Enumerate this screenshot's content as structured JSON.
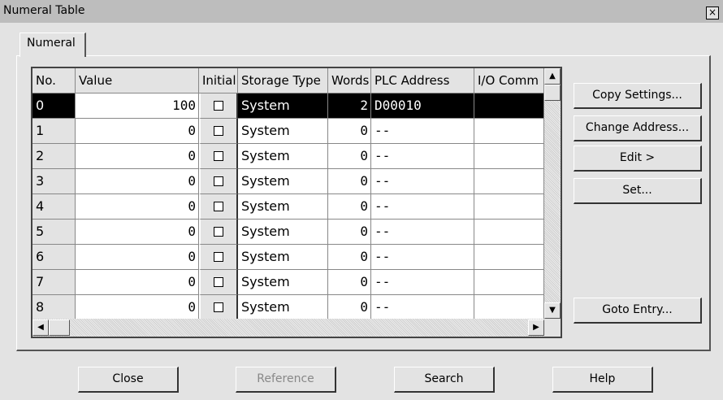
{
  "window": {
    "title": "Numeral Table",
    "close_label": "×"
  },
  "tabs": [
    {
      "label": "Numeral"
    }
  ],
  "table": {
    "columns": [
      "No.",
      "Value",
      "Initial",
      "Storage Type",
      "Words",
      "PLC Address",
      "I/O Comm"
    ],
    "rows": [
      {
        "no": "0",
        "value": "100",
        "initial": false,
        "storage": "System",
        "words": "2",
        "plc": "D00010",
        "io": "",
        "selected": true
      },
      {
        "no": "1",
        "value": "0",
        "initial": false,
        "storage": "System",
        "words": "0",
        "plc": "--",
        "io": ""
      },
      {
        "no": "2",
        "value": "0",
        "initial": false,
        "storage": "System",
        "words": "0",
        "plc": "--",
        "io": ""
      },
      {
        "no": "3",
        "value": "0",
        "initial": false,
        "storage": "System",
        "words": "0",
        "plc": "--",
        "io": ""
      },
      {
        "no": "4",
        "value": "0",
        "initial": false,
        "storage": "System",
        "words": "0",
        "plc": "--",
        "io": ""
      },
      {
        "no": "5",
        "value": "0",
        "initial": false,
        "storage": "System",
        "words": "0",
        "plc": "--",
        "io": ""
      },
      {
        "no": "6",
        "value": "0",
        "initial": false,
        "storage": "System",
        "words": "0",
        "plc": "--",
        "io": ""
      },
      {
        "no": "7",
        "value": "0",
        "initial": false,
        "storage": "System",
        "words": "0",
        "plc": "--",
        "io": ""
      },
      {
        "no": "8",
        "value": "0",
        "initial": false,
        "storage": "System",
        "words": "0",
        "plc": "--",
        "io": ""
      }
    ]
  },
  "side_buttons": {
    "copy_settings": "Copy Settings...",
    "change_address": "Change Address...",
    "edit": "Edit >",
    "set": "Set...",
    "goto_entry": "Goto Entry..."
  },
  "bottom_buttons": {
    "close": "Close",
    "reference": "Reference",
    "search": "Search",
    "help": "Help"
  },
  "scroll": {
    "up": "▲",
    "down": "▼",
    "left": "◀",
    "right": "▶"
  }
}
